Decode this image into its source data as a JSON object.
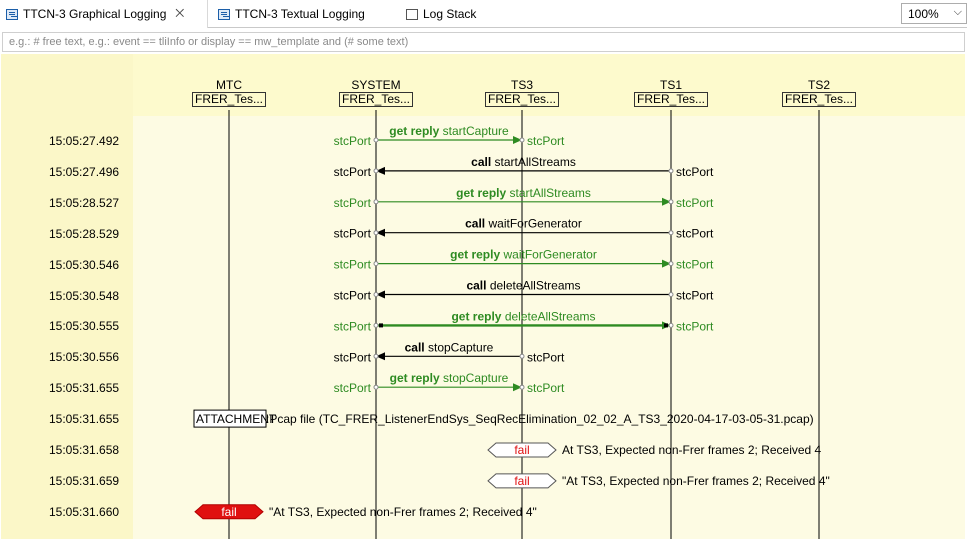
{
  "tabs": [
    {
      "label": "TTCN-3 Graphical Logging",
      "close": "⨉"
    },
    {
      "label": "TTCN-3 Textual Logging"
    },
    {
      "label": "Log Stack"
    }
  ],
  "zoom": {
    "value": "100%"
  },
  "filter": {
    "placeholder": "e.g.: # free text, e.g.: event == tliInfo or display == mw_template and (# some text)"
  },
  "components": [
    {
      "name": "MTC",
      "label": "FRER_Tes..."
    },
    {
      "name": "SYSTEM",
      "label": "FRER_Tes..."
    },
    {
      "name": "TS3",
      "label": "FRER_Tes..."
    },
    {
      "name": "TS1",
      "label": "FRER_Tes..."
    },
    {
      "name": "TS2",
      "label": "FRER_Tes..."
    }
  ],
  "rows": [
    {
      "time": "15:05:27.492",
      "kind": "msg",
      "keyword": "get reply",
      "op": "startCapture",
      "from": "SYSTEM",
      "to": "TS3",
      "color": "green",
      "left_port": "stcPort",
      "right_port": "stcPort"
    },
    {
      "time": "15:05:27.496",
      "kind": "msg",
      "keyword": "call",
      "op": "startAllStreams",
      "from": "TS1",
      "to": "SYSTEM",
      "color": "black",
      "left_port": "stcPort",
      "right_port": "stcPort"
    },
    {
      "time": "15:05:28.527",
      "kind": "msg",
      "keyword": "get reply",
      "op": "startAllStreams",
      "from": "SYSTEM",
      "to": "TS1",
      "color": "green",
      "left_port": "stcPort",
      "right_port": "stcPort"
    },
    {
      "time": "15:05:28.529",
      "kind": "msg",
      "keyword": "call",
      "op": "waitForGenerator",
      "from": "TS1",
      "to": "SYSTEM",
      "color": "black",
      "left_port": "stcPort",
      "right_port": "stcPort"
    },
    {
      "time": "15:05:30.546",
      "kind": "msg",
      "keyword": "get reply",
      "op": "waitForGenerator",
      "from": "SYSTEM",
      "to": "TS1",
      "color": "green",
      "left_port": "stcPort",
      "right_port": "stcPort"
    },
    {
      "time": "15:05:30.548",
      "kind": "msg",
      "keyword": "call",
      "op": "deleteAllStreams",
      "from": "TS1",
      "to": "SYSTEM",
      "color": "black",
      "left_port": "stcPort",
      "right_port": "stcPort"
    },
    {
      "time": "15:05:30.555",
      "kind": "msg",
      "keyword": "get reply",
      "op": "deleteAllStreams",
      "from": "SYSTEM",
      "to": "TS1",
      "color": "green",
      "bold": true,
      "left_port": "stcPort",
      "right_port": "stcPort"
    },
    {
      "time": "15:05:30.556",
      "kind": "msg",
      "keyword": "call",
      "op": "stopCapture",
      "from": "TS3",
      "to": "SYSTEM",
      "color": "black",
      "left_port": "stcPort",
      "right_port": "stcPort"
    },
    {
      "time": "15:05:31.655",
      "kind": "msg",
      "keyword": "get reply",
      "op": "stopCapture",
      "from": "SYSTEM",
      "to": "TS3",
      "color": "green",
      "left_port": "stcPort",
      "right_port": "stcPort"
    },
    {
      "time": "15:05:31.655",
      "kind": "attach",
      "at": "MTC",
      "tag": "ATTACHMENT",
      "text": ":Pcap file (TC_FRER_ListenerEndSys_SeqRecElimination_02_02_A_TS3_2020-04-17-03-05-31.pcap)"
    },
    {
      "time": "15:05:31.658",
      "kind": "verdict",
      "at": "TS3",
      "verdict": "fail",
      "fill": "none",
      "text": "At TS3, Expected non-Frer frames 2; Received 4"
    },
    {
      "time": "15:05:31.659",
      "kind": "verdict",
      "at": "TS3",
      "verdict": "fail",
      "fill": "none",
      "text": "\"At TS3, Expected non-Frer frames 2; Received 4\""
    },
    {
      "time": "15:05:31.660",
      "kind": "verdict",
      "at": "MTC",
      "verdict": "fail",
      "fill": "red",
      "text": "\"At TS3, Expected non-Frer frames 2; Received 4\""
    }
  ],
  "colors": {
    "green": "#2e8b22",
    "black": "#000000",
    "fail_red": "#e01010",
    "fail_text": "#e01010",
    "band": "#fdfacd"
  }
}
